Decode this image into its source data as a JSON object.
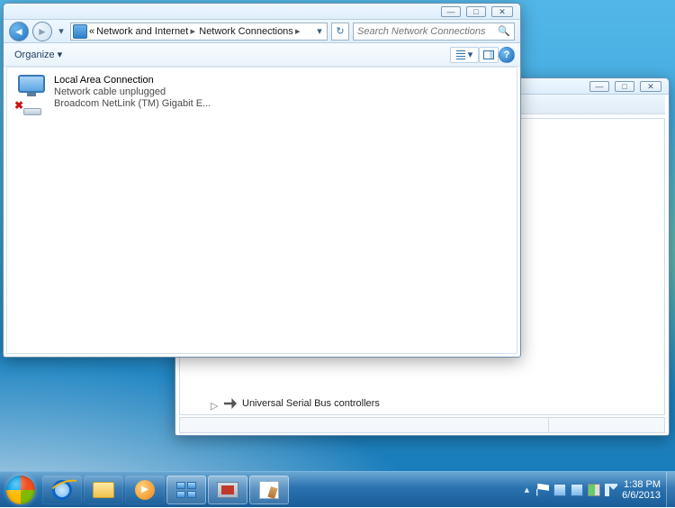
{
  "window": {
    "minimize": "—",
    "maximize": "□",
    "close": "✕",
    "breadcrumb": {
      "overflow": "«",
      "level1": "Network and Internet",
      "level2": "Network Connections",
      "sep": "▸"
    },
    "search_placeholder": "Search Network Connections",
    "toolbar": {
      "organize": "Organize",
      "organize_arrow": "▾",
      "views_arrow": "▾",
      "help": "?"
    },
    "connection": {
      "name": "Local Area Connection",
      "status": "Network cable unplugged",
      "device": "Broadcom NetLink (TM) Gigabit E...",
      "error_mark": "✖"
    }
  },
  "bg_window": {
    "tree_item": "Universal Serial Bus controllers",
    "expander": "▷"
  },
  "taskbar": {
    "tray_arrow": "▴",
    "time": "1:38 PM",
    "date": "6/6/2013"
  }
}
